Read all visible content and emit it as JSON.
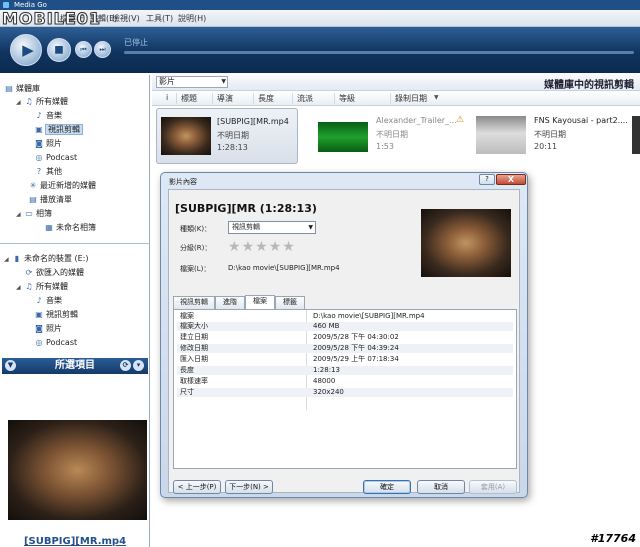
{
  "window": {
    "title": "Media Go"
  },
  "logo": {
    "text": "MOBILE01"
  },
  "menu": [
    "檔案(F)",
    "編輯(E)",
    "檢視(V)",
    "工具(T)",
    "說明(H)"
  ],
  "player": {
    "status": "已停止"
  },
  "sidebar": {
    "library": {
      "title": "媒體庫",
      "all_media": "所有媒體",
      "music": "音樂",
      "video": "視訊剪輯",
      "photos": "照片",
      "podcast": "Podcast",
      "other": "其他",
      "recent": "最近新增的媒體",
      "playlists": "播放清單",
      "albums": "相簿",
      "unnamed_album": "未命名相簿"
    },
    "device": {
      "title": "未命名的裝置 (E:)",
      "imported": "欲匯入的媒體",
      "all_media": "所有媒體",
      "music": "音樂",
      "video": "視訊剪輯",
      "photos": "照片",
      "podcast": "Podcast"
    }
  },
  "selected_panel": {
    "title": "所選項目",
    "filename": "[SUBPIG][MR.mp4"
  },
  "content": {
    "filter": "影片",
    "title": "媒體庫中的視訊剪輯",
    "columns": [
      "i",
      "標題",
      "導演",
      "長度",
      "流派",
      "等級",
      "錄制日期"
    ],
    "items": [
      {
        "name": "[SUBPIG][MR.mp4",
        "date": "不明日期",
        "duration": "1:28:13"
      },
      {
        "name": "Alexander_Trailer_...",
        "date": "不明日期",
        "duration": "1:53"
      },
      {
        "name": "FNS Kayousai - part2....",
        "date": "不明日期",
        "duration": "20:11"
      }
    ]
  },
  "dialog": {
    "title": "影片內容",
    "help_label": "?",
    "close_label": "X",
    "heading": "[SUBPIG][MR (1:28:13)",
    "genre_label": "種類(K)：",
    "genre_value": "視訊剪輯",
    "rating_label": "分級(R)：",
    "file_label": "檔案(L)：",
    "file_path": "D:\\kao movie\\[SUBPIG][MR.mp4",
    "rating_stars": 0,
    "tabs": [
      "視訊剪輯",
      "進階",
      "檔案",
      "標籤"
    ],
    "active_tab": "檔案",
    "properties": [
      {
        "k": "檔案",
        "v": "D:\\kao movie\\[SUBPIG][MR.mp4"
      },
      {
        "k": "檔案大小",
        "v": "460 MB"
      },
      {
        "k": "建立日期",
        "v": "2009/5/28 下午 04:30:02"
      },
      {
        "k": "修改日期",
        "v": "2009/5/28 下午 04:39:24"
      },
      {
        "k": "匯入日期",
        "v": "2009/5/29 上午 07:18:34"
      },
      {
        "k": "長度",
        "v": "1:28:13"
      },
      {
        "k": "取樣速率",
        "v": "48000"
      },
      {
        "k": "尺寸",
        "v": "320x240"
      }
    ],
    "buttons": {
      "prev": "< 上一步(P)",
      "next": "下一步(N) >",
      "ok": "確定",
      "cancel": "取消",
      "apply": "套用(A)"
    }
  },
  "watermark": "#17764"
}
